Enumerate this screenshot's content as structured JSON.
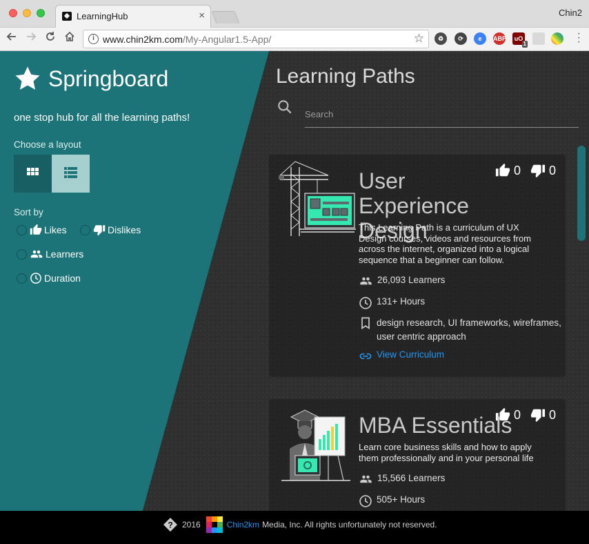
{
  "browser": {
    "tab_title": "LearningHub",
    "tab_close": "×",
    "profile_name": "Chin2",
    "url_host": "www.chin2km.com",
    "url_path": "/My-Angular1.5-App/",
    "extensions": [
      "recycle-icon",
      "sync-icon",
      "edge-icon",
      "adblock-icon",
      "ublock-icon",
      "puzzle-icon",
      "pinwheel-icon"
    ],
    "adblock_label": "ABP",
    "ublock_badge": "1"
  },
  "sidebar": {
    "brand": "Springboard",
    "tagline": "one stop hub for all the learning paths!",
    "layout_label": "Choose a layout",
    "sort_label": "Sort by",
    "sort_options": [
      "Likes",
      "Dislikes",
      "Learners",
      "Duration"
    ],
    "colors": {
      "teal": "#1c7478",
      "layout_active": "#a6cfd0"
    }
  },
  "main": {
    "title": "Learning Paths",
    "search_placeholder": "Search",
    "cards": [
      {
        "title": "User Experience Design",
        "description": "This Learning Path is a curriculum of UX Design courses, videos and resources from across the internet, organized into a logical sequence that a beginner can follow.",
        "likes": "0",
        "dislikes": "0",
        "learners": "26,093 Learners",
        "duration": "131+ Hours",
        "tags": "design research, UI frameworks, wireframes, user centric approach",
        "link": "View Curriculum"
      },
      {
        "title": "MBA Essentials",
        "description": "Learn core business skills and how to apply them professionally and in your personal life",
        "likes": "0",
        "dislikes": "0",
        "learners": "15,566 Learners",
        "duration": "505+ Hours"
      }
    ]
  },
  "footer": {
    "year": "2016",
    "brand": "Chin2km",
    "rights": "Media, Inc. All rights unfortunately not reserved."
  }
}
